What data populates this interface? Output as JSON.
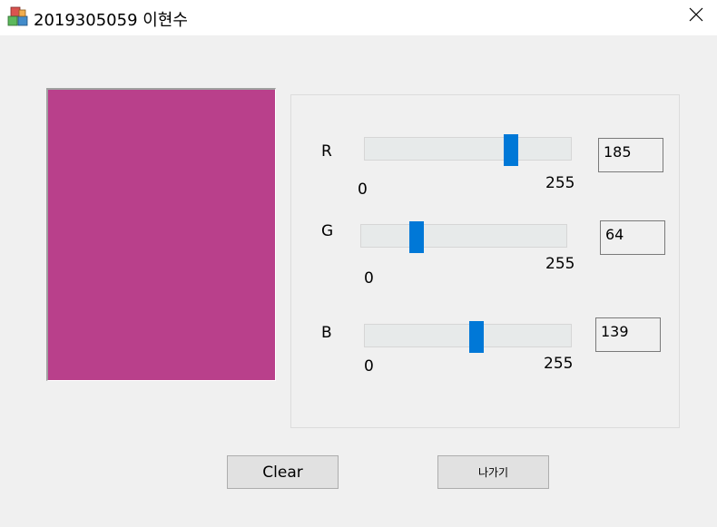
{
  "window": {
    "title": "2019305059 이현수",
    "icon": "app-blocks-icon",
    "close_icon": "close-icon"
  },
  "preview": {
    "color": "#b9408b"
  },
  "sliders": [
    {
      "channel": "R",
      "value": "185",
      "min_label": "0",
      "max_label": "255",
      "level": 185,
      "max": 255
    },
    {
      "channel": "G",
      "value": "64",
      "min_label": "0",
      "max_label": "255",
      "level": 64,
      "max": 255
    },
    {
      "channel": "B",
      "value": "139",
      "min_label": "0",
      "max_label": "255",
      "level": 139,
      "max": 255
    }
  ],
  "buttons": {
    "clear": "Clear",
    "exit": "나가기"
  }
}
